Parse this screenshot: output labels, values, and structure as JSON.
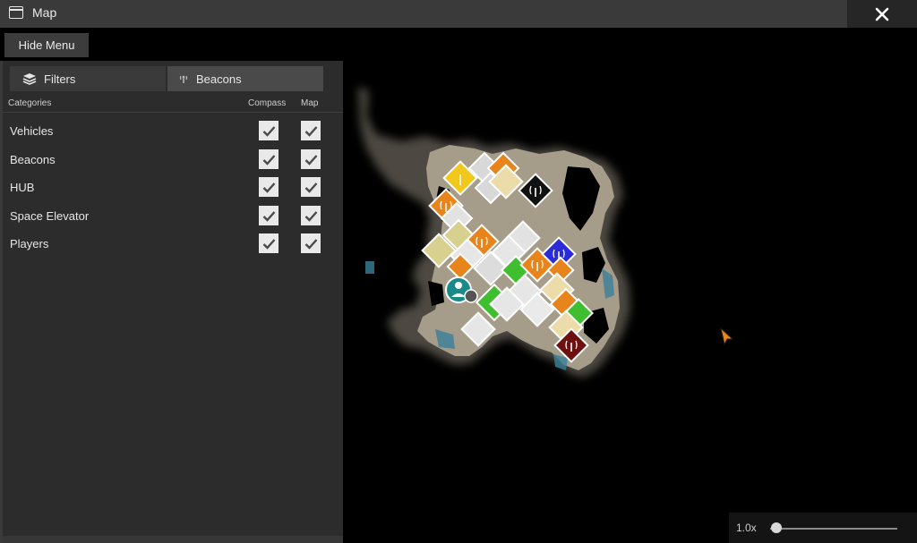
{
  "window": {
    "title": "Map"
  },
  "toolbar": {
    "hide_menu_label": "Hide Menu"
  },
  "tabs": [
    {
      "label": "Filters",
      "icon": "layers-icon"
    },
    {
      "label": "Beacons",
      "icon": "beacon-icon"
    }
  ],
  "table": {
    "headers": {
      "category": "Categories",
      "compass": "Compass",
      "map": "Map"
    },
    "rows": [
      {
        "label": "Vehicles",
        "compass": true,
        "map": true
      },
      {
        "label": "Beacons",
        "compass": true,
        "map": true
      },
      {
        "label": "HUB",
        "compass": true,
        "map": true
      },
      {
        "label": "Space Elevator",
        "compass": true,
        "map": true
      },
      {
        "label": "Players",
        "compass": true,
        "map": true
      }
    ]
  },
  "zoom": {
    "label": "1.0x",
    "level": 0.0
  },
  "colors": {
    "titlebar": "#3a3a3a",
    "panel": "#2c2c2c",
    "land": "#a69c8a",
    "beacon_orange": "#e8841c",
    "beacon_yellow": "#f2c81c",
    "beacon_blue": "#2a2ad8",
    "beacon_darkred": "#6e1010",
    "beacon_black": "#111111",
    "player": "#1a8a88"
  }
}
